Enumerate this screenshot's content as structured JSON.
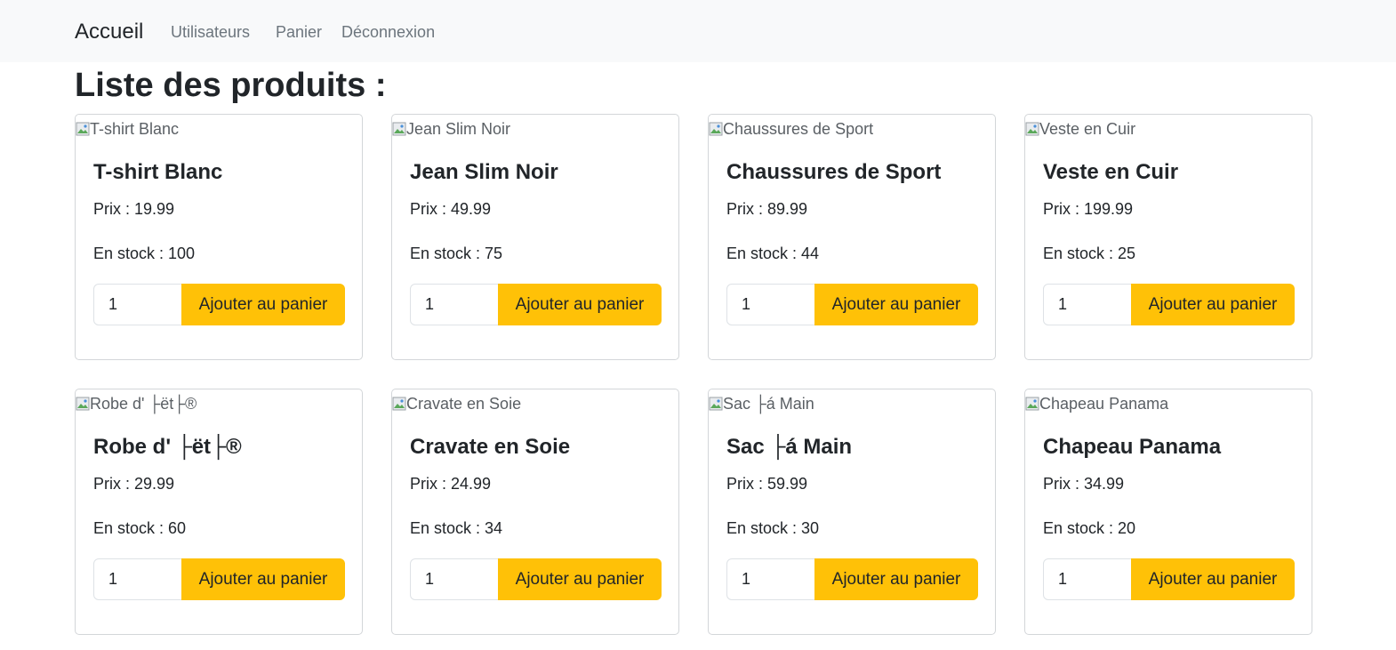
{
  "navbar": {
    "brand": "Accueil",
    "links": [
      "Utilisateurs",
      "Panier",
      "Déconnexion"
    ]
  },
  "page": {
    "title": "Liste des produits :"
  },
  "colors": {
    "navbar_bg": "#f8f9fa",
    "button_bg": "#ffc107",
    "nav_link": "#6c757d"
  },
  "products": [
    {
      "image_alt": "T-shirt Blanc",
      "name": "T-shirt Blanc",
      "price": "Prix : 19.99",
      "stock": "En stock : 100",
      "quantity": "1",
      "button": "Ajouter au panier"
    },
    {
      "image_alt": "Jean Slim Noir",
      "name": "Jean Slim Noir",
      "price": "Prix : 49.99",
      "stock": "En stock : 75",
      "quantity": "1",
      "button": "Ajouter au panier"
    },
    {
      "image_alt": "Chaussures de Sport",
      "name": "Chaussures de Sport",
      "price": "Prix : 89.99",
      "stock": "En stock : 44",
      "quantity": "1",
      "button": "Ajouter au panier"
    },
    {
      "image_alt": "Veste en Cuir",
      "name": "Veste en Cuir",
      "price": "Prix : 199.99",
      "stock": "En stock : 25",
      "quantity": "1",
      "button": "Ajouter au panier"
    },
    {
      "image_alt": "Robe d' ├ët├®",
      "name": "Robe d' ├ët├®",
      "price": "Prix : 29.99",
      "stock": "En stock : 60",
      "quantity": "1",
      "button": "Ajouter au panier"
    },
    {
      "image_alt": "Cravate en Soie",
      "name": "Cravate en Soie",
      "price": "Prix : 24.99",
      "stock": "En stock : 34",
      "quantity": "1",
      "button": "Ajouter au panier"
    },
    {
      "image_alt": "Sac ├á Main",
      "name": "Sac ├á Main",
      "price": "Prix : 59.99",
      "stock": "En stock : 30",
      "quantity": "1",
      "button": "Ajouter au panier"
    },
    {
      "image_alt": "Chapeau Panama",
      "name": "Chapeau Panama",
      "price": "Prix : 34.99",
      "stock": "En stock : 20",
      "quantity": "1",
      "button": "Ajouter au panier"
    }
  ]
}
